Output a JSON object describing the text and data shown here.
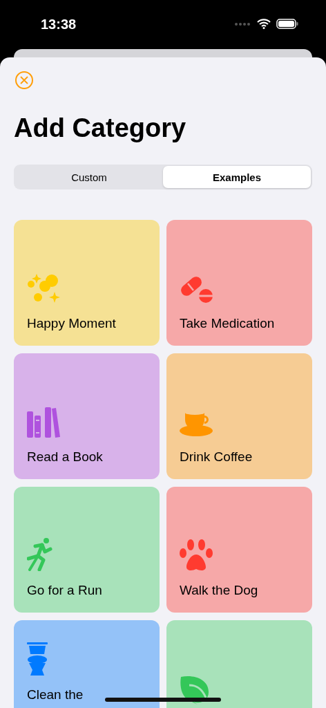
{
  "status_bar": {
    "time": "13:38"
  },
  "title": "Add Category",
  "tabs": [
    {
      "label": "Custom",
      "selected": false
    },
    {
      "label": "Examples",
      "selected": true
    }
  ],
  "categories": [
    {
      "kind": "sparkles",
      "label": "Happy Moment",
      "color": "#f5e194"
    },
    {
      "kind": "pills",
      "label": "Take Medication",
      "color": "#f6a8a8"
    },
    {
      "kind": "books",
      "label": "Read a Book",
      "color": "#d8b2ea"
    },
    {
      "kind": "cup",
      "label": "Drink Coffee",
      "color": "#f6cc94"
    },
    {
      "kind": "runner",
      "label": "Go for a Run",
      "color": "#a8e2ba"
    },
    {
      "kind": "paw",
      "label": "Walk the Dog",
      "color": "#f6a8a8"
    },
    {
      "kind": "toilet",
      "label": "Clean the",
      "wrapped": true,
      "color": "#94c2f8"
    },
    {
      "kind": "leaf",
      "color": "#a8e2ba"
    }
  ]
}
